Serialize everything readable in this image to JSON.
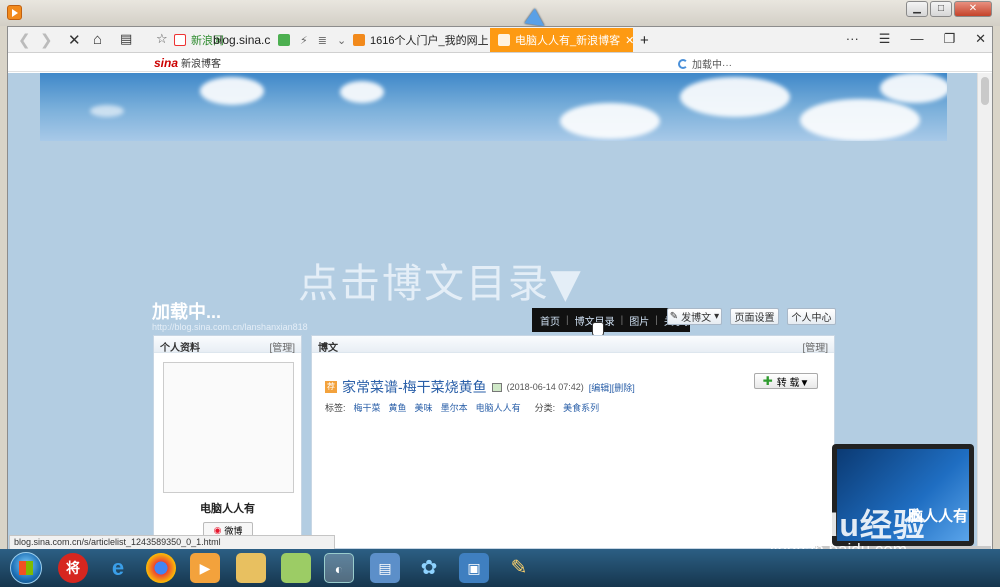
{
  "browser": {
    "tabs": [
      {
        "label": "新浪网"
      },
      {
        "label": "blog.sina.c"
      },
      {
        "label": "1616个人门户_我的网上家园"
      },
      {
        "label": "电脑人人有_新浪博客",
        "active": true
      }
    ],
    "new_tab_label": "+",
    "menu_label": "···",
    "sina_logo": "sina",
    "sina_logo_sub": "新浪博客",
    "loading_text": "加载中···",
    "status_url": "blog.sina.com.cn/s/articlelist_1243589350_0_1.html"
  },
  "page": {
    "hint": "点击博文目录▼",
    "blog_title": "加载中...",
    "blog_url": "http://blog.sina.com.cn/lanshanxian818",
    "nav": {
      "items": [
        "首页",
        "博文目录",
        "图片",
        "关于我"
      ]
    },
    "buttons": {
      "post": "发博文",
      "page_settings": "页面设置",
      "personal_center": "个人中心"
    },
    "profile": {
      "heading": "个人资料",
      "manage": "[管理]",
      "name": "电脑人人有",
      "weibo": "微博"
    },
    "articles": {
      "heading": "博文",
      "manage": "[管理]",
      "tag_badge": "荐",
      "title": "家常菜谱-梅干菜烧黄鱼",
      "date": "(2018-06-14 07:42)",
      "edit": "[编辑]",
      "delete": "[删除]",
      "repost": "转 载▼",
      "tags_label": "标签:",
      "tags": [
        "梅干菜",
        "黄鱼",
        "美味",
        "墨尔本",
        "电脑人人有"
      ],
      "category_label": "分类:",
      "category": "美食系列"
    }
  },
  "watermark": {
    "brand": "Baidu经验",
    "url": "jingyan.baidu.com",
    "laptop_text": "脑人人有"
  },
  "colors": {
    "accent_tab": "#fd9a13",
    "page_bg": "#b3cde2",
    "link": "#2a5fa8"
  }
}
